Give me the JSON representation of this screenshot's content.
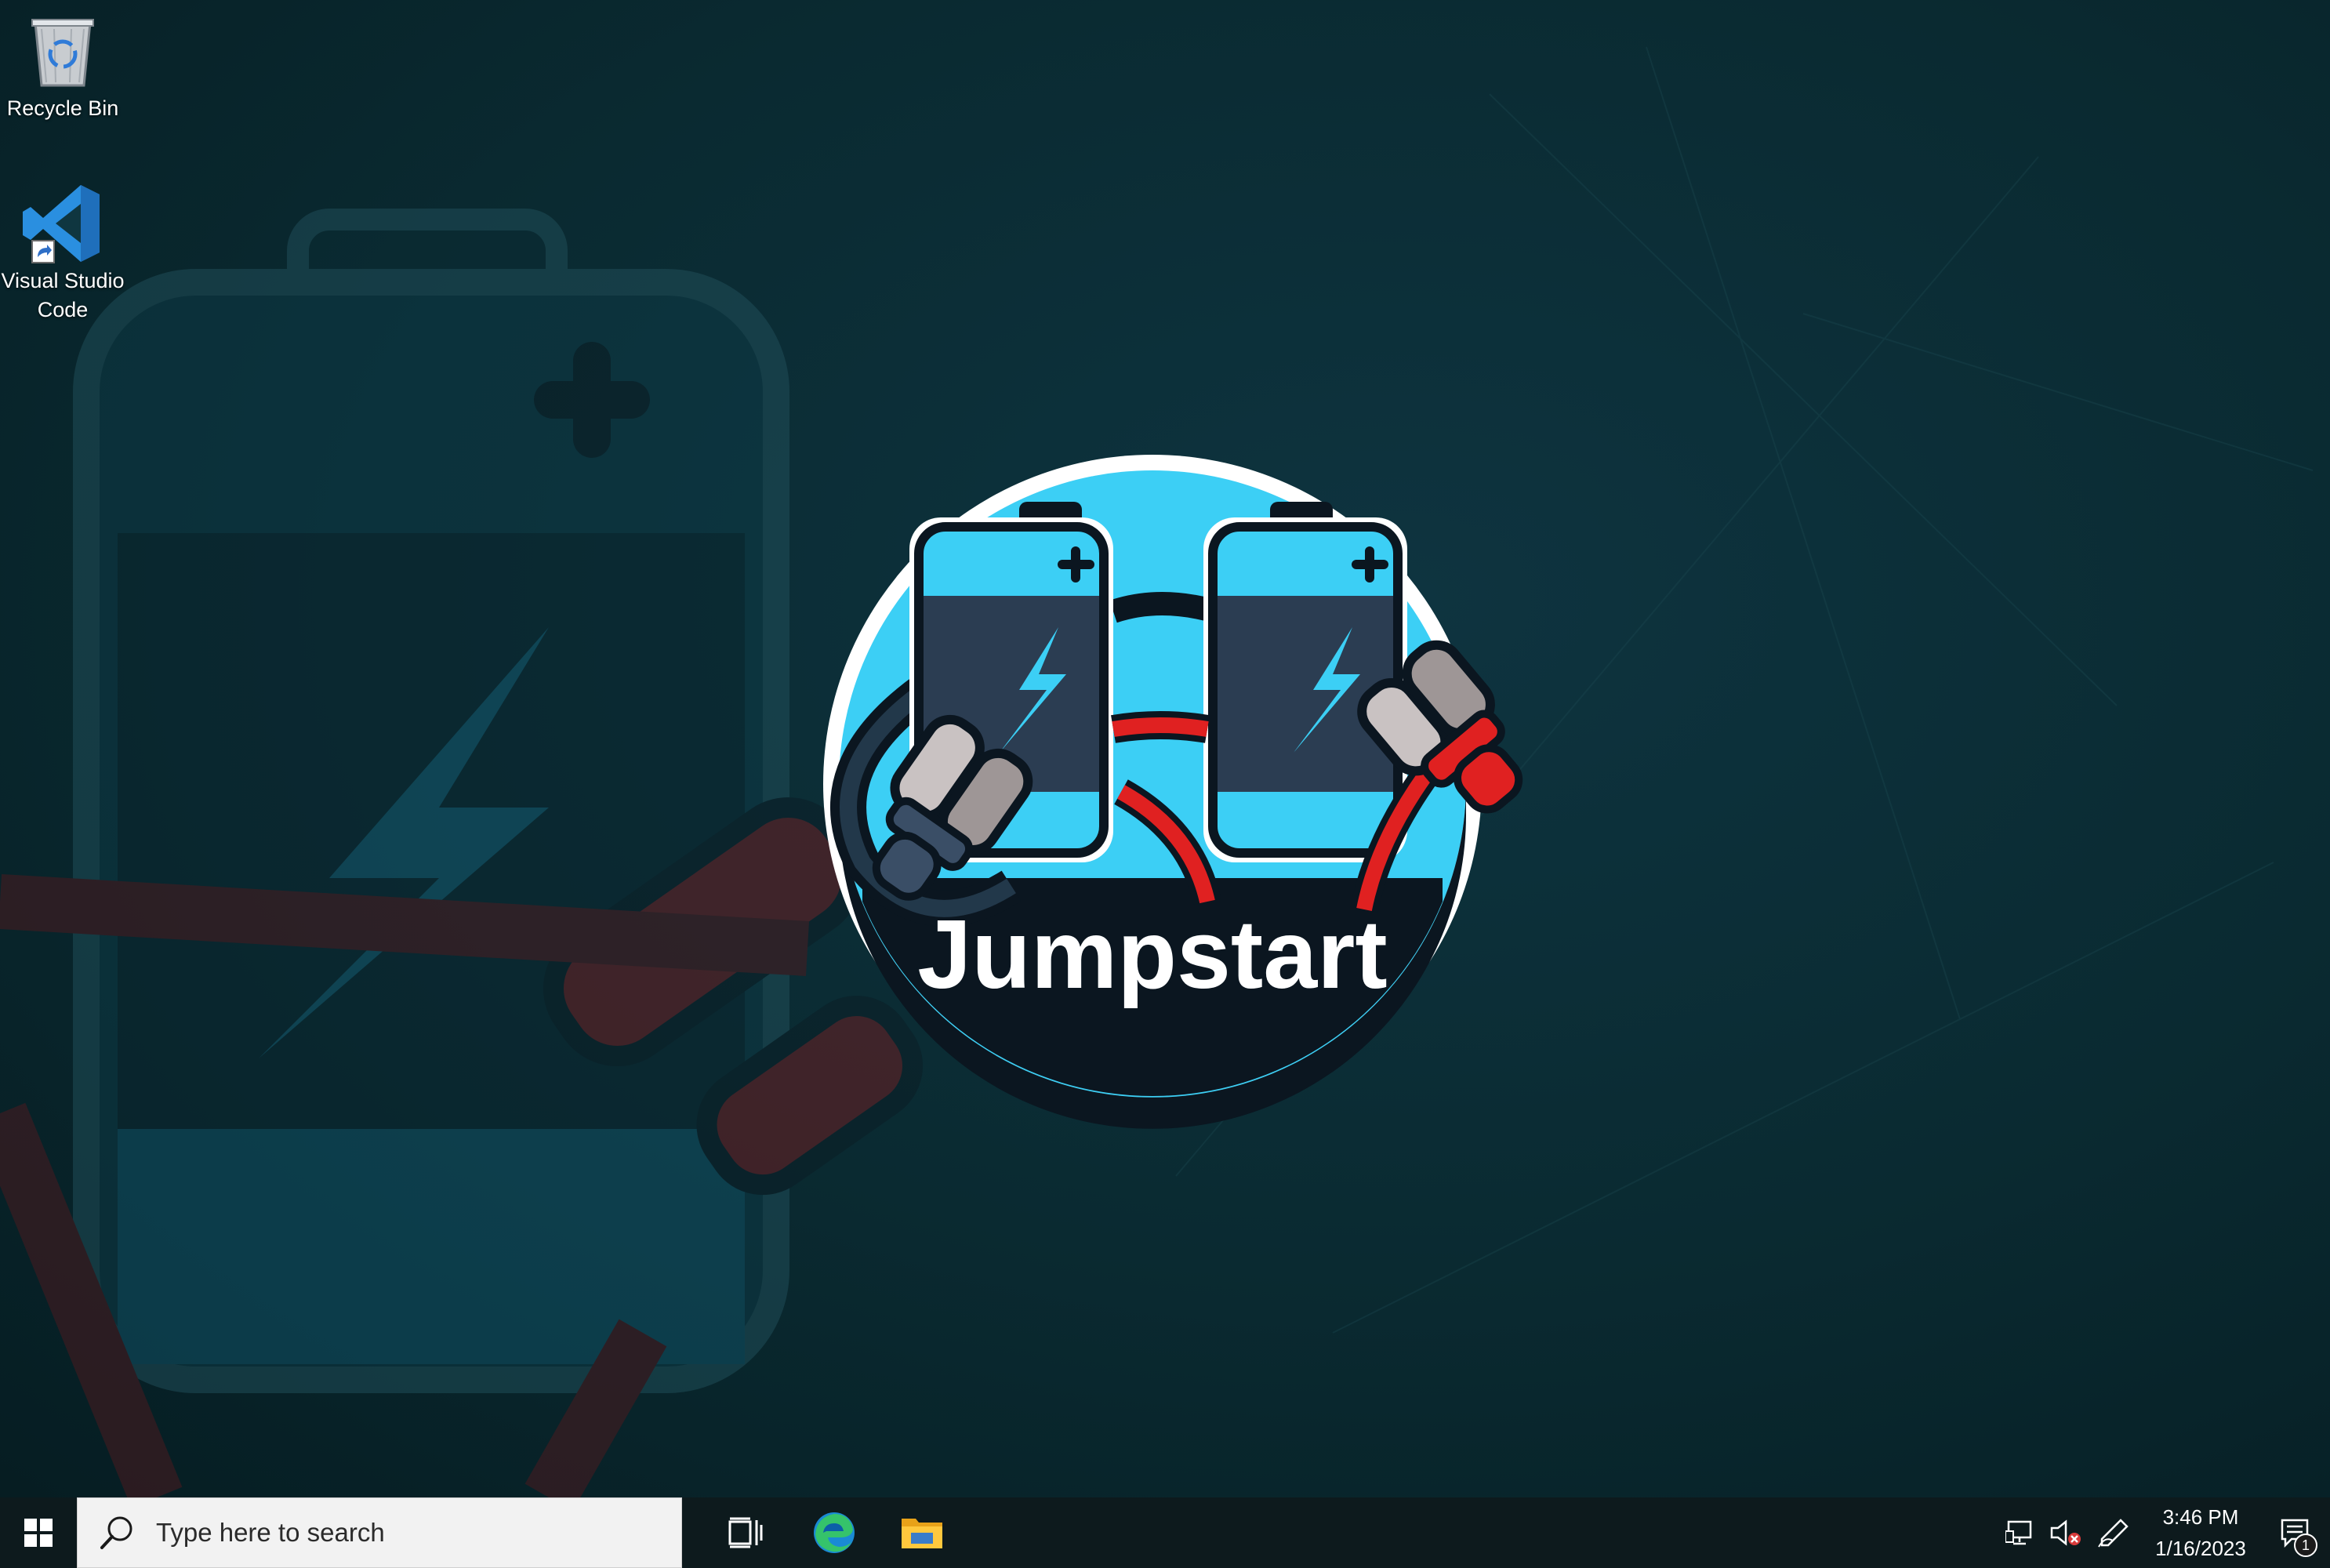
{
  "desktop": {
    "icons": [
      {
        "label": "Recycle Bin",
        "icon": "recycle-bin-icon"
      },
      {
        "label": "Visual Studio Code",
        "icon": "vscode-icon"
      }
    ],
    "wallpaper": {
      "logo_text": "Jumpstart",
      "colors": {
        "background": "#082329",
        "battery_blue": "#3ccff5",
        "cable_red": "#e02121",
        "outline": "#0b1620"
      }
    }
  },
  "taskbar": {
    "start_icon": "windows-icon",
    "search": {
      "placeholder": "Type here to search",
      "icon": "search-icon"
    },
    "apps": [
      {
        "name": "Task View",
        "icon": "task-view-icon"
      },
      {
        "name": "Microsoft Edge",
        "icon": "edge-icon"
      },
      {
        "name": "File Explorer",
        "icon": "file-explorer-icon"
      }
    ],
    "tray": {
      "icons": [
        "network-icon",
        "volume-muted-icon",
        "pen-icon"
      ],
      "time": "3:46 PM",
      "date": "1/16/2023",
      "notification_count": "1"
    }
  }
}
